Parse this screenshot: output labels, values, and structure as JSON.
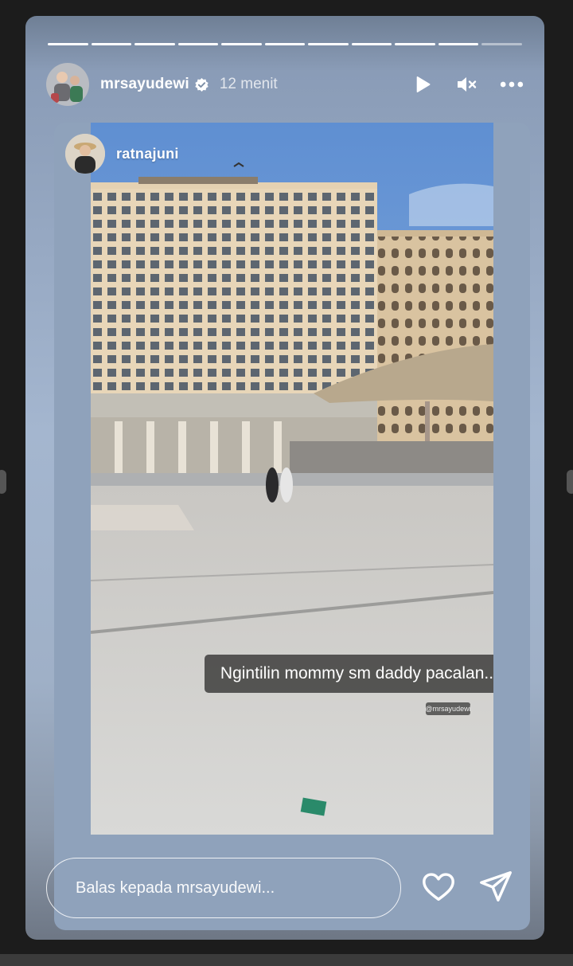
{
  "story": {
    "progress_segments": 11,
    "progress_filled": 10,
    "author": {
      "username": "mrsayudewi",
      "verified": true,
      "time_ago": "12 menit"
    },
    "controls": {
      "play_icon": "play-icon",
      "mute_icon": "muted-speaker-icon",
      "more_icon": "more-horizontal-icon"
    },
    "repost": {
      "username": "ratnajuni",
      "caption": "Ngintilin mommy sm daddy pacalan..",
      "watermark": "@mrsayudewi"
    },
    "reply": {
      "placeholder": "Balas kepada mrsayudewi..."
    },
    "actions": {
      "like_icon": "heart-icon",
      "share_icon": "send-icon"
    }
  },
  "colors": {
    "background": "#1c1c1c",
    "text": "#ffffff"
  }
}
